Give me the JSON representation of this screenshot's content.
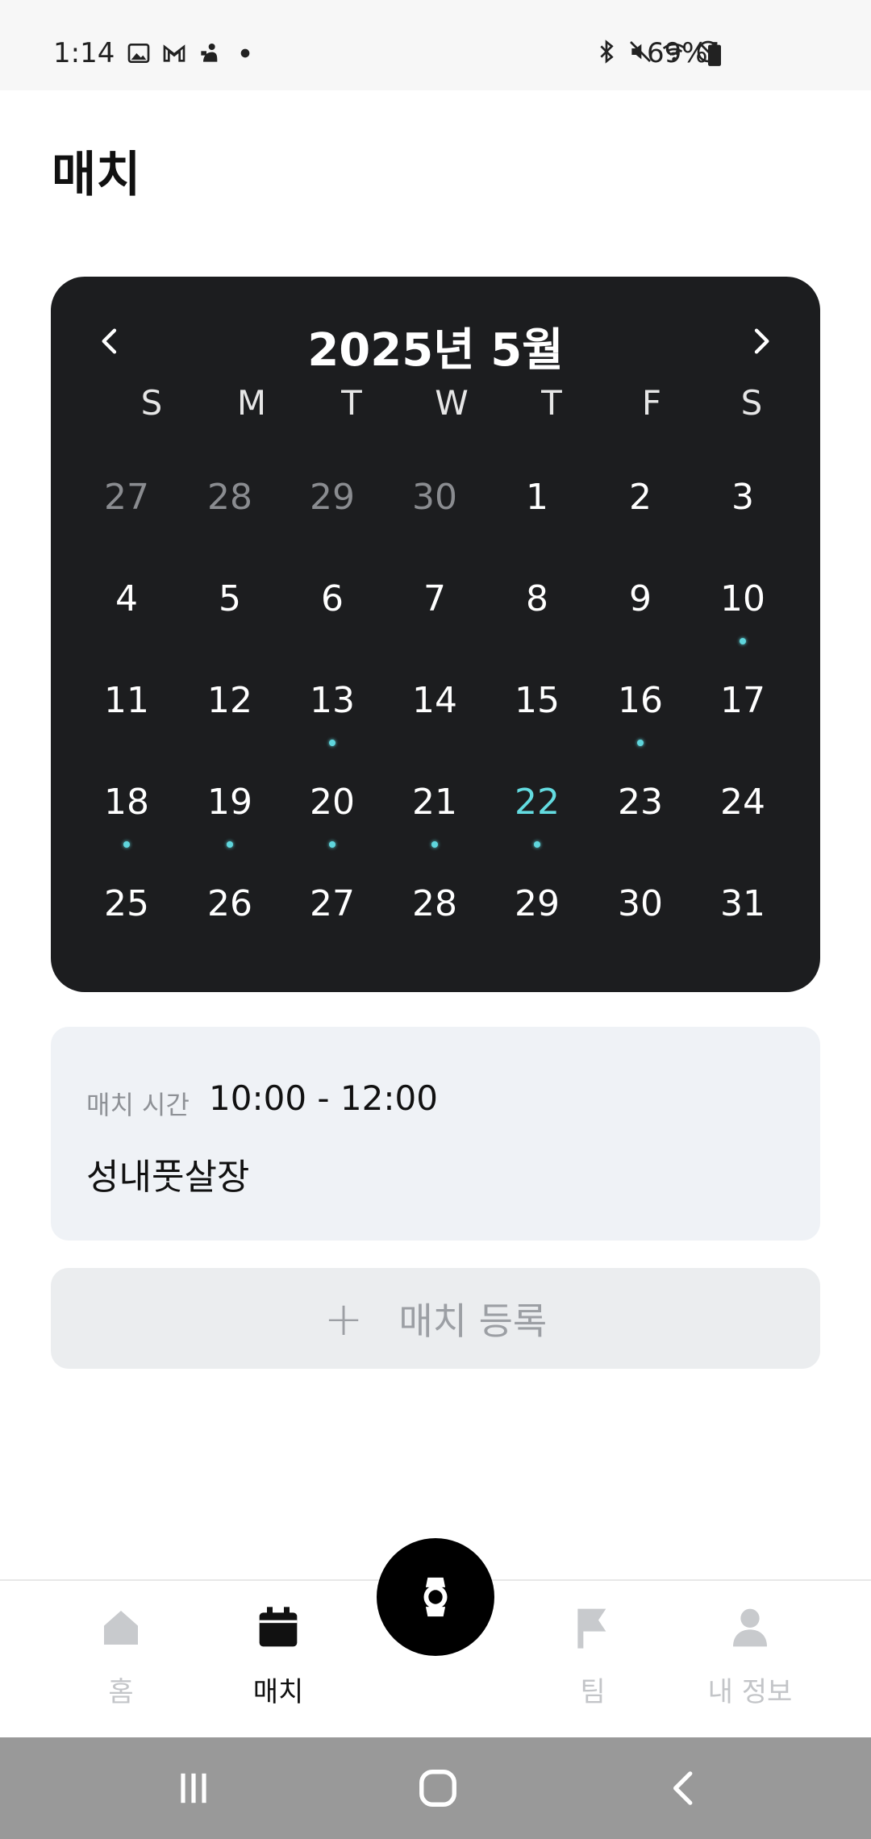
{
  "status_bar": {
    "time": "1:14",
    "battery_percent": "69%",
    "left_icons": [
      "gallery-icon",
      "gmail-icon",
      "app-notification-icon",
      "dot-icon"
    ],
    "right_icons": [
      "bluetooth-icon",
      "mute-icon",
      "wifi-icon",
      "do-not-disturb-icon",
      "battery-icon"
    ]
  },
  "page": {
    "title": "매치"
  },
  "calendar": {
    "title": "2025년 5월",
    "weekdays": [
      "S",
      "M",
      "T",
      "W",
      "T",
      "F",
      "S"
    ],
    "weeks": [
      [
        {
          "d": "27",
          "muted": true
        },
        {
          "d": "28",
          "muted": true
        },
        {
          "d": "29",
          "muted": true
        },
        {
          "d": "30",
          "muted": true
        },
        {
          "d": "1"
        },
        {
          "d": "2"
        },
        {
          "d": "3"
        }
      ],
      [
        {
          "d": "4"
        },
        {
          "d": "5"
        },
        {
          "d": "6"
        },
        {
          "d": "7"
        },
        {
          "d": "8"
        },
        {
          "d": "9"
        },
        {
          "d": "10",
          "dot": true
        }
      ],
      [
        {
          "d": "11"
        },
        {
          "d": "12"
        },
        {
          "d": "13",
          "dot": true
        },
        {
          "d": "14"
        },
        {
          "d": "15"
        },
        {
          "d": "16",
          "dot": true
        },
        {
          "d": "17"
        }
      ],
      [
        {
          "d": "18",
          "dot": true
        },
        {
          "d": "19",
          "dot": true
        },
        {
          "d": "20",
          "dot": true
        },
        {
          "d": "21",
          "dot": true
        },
        {
          "d": "22",
          "dot": true,
          "selected": true
        },
        {
          "d": "23"
        },
        {
          "d": "24"
        }
      ],
      [
        {
          "d": "25"
        },
        {
          "d": "26"
        },
        {
          "d": "27"
        },
        {
          "d": "28"
        },
        {
          "d": "29"
        },
        {
          "d": "30"
        },
        {
          "d": "31"
        }
      ]
    ],
    "accent_color": "#63dbe0",
    "background_color": "#1c1d1f"
  },
  "match": {
    "time_label": "매치 시간",
    "time": "10:00 - 12:00",
    "venue": "성내풋살장"
  },
  "register": {
    "plus": "+",
    "label": "매치 등록"
  },
  "bottom_nav": {
    "items": [
      {
        "label": "홈",
        "icon": "home-icon",
        "active": false
      },
      {
        "label": "매치",
        "icon": "calendar-icon",
        "active": true
      },
      {
        "label": "팀",
        "icon": "flag-icon",
        "active": false
      },
      {
        "label": "내 정보",
        "icon": "person-icon",
        "active": false
      }
    ],
    "center_icon": "watch-icon"
  },
  "system_nav": [
    "recent-apps-icon",
    "home-button-icon",
    "back-icon"
  ]
}
